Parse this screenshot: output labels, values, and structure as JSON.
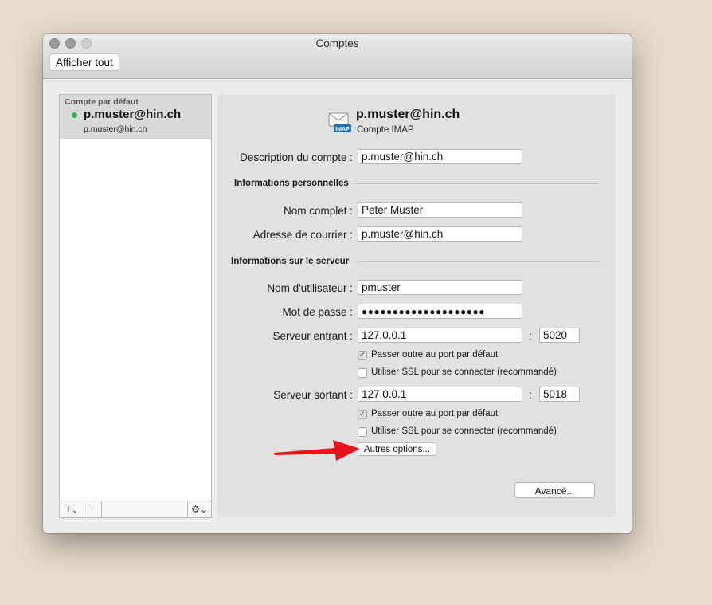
{
  "window": {
    "title": "Comptes",
    "show_all_label": "Afficher tout"
  },
  "sidebar": {
    "group_label": "Compte par défaut",
    "accounts": [
      {
        "name": "p.muster@hin.ch",
        "email": "p.muster@hin.ch",
        "status_color": "#2fb84a"
      }
    ],
    "add_label": "+",
    "add_chevron": "⌄",
    "remove_label": "−",
    "gear_label": "⚙⌄"
  },
  "account": {
    "header_email": "p.muster@hin.ch",
    "type": "Compte IMAP",
    "icon_badge": "IMAP",
    "icon": "mail-envelope-icon",
    "description_label": "Description du compte :",
    "description_value": "p.muster@hin.ch",
    "personal_section": "Informations personnelles",
    "full_name_label": "Nom complet :",
    "full_name_value": "Peter Muster",
    "email_label": "Adresse de courrier :",
    "email_value": "p.muster@hin.ch",
    "server_section": "Informations sur le serveur",
    "username_label": "Nom d'utilisateur :",
    "username_value": "pmuster",
    "password_label": "Mot de passe :",
    "password_value": "●●●●●●●●●●●●●●●●●●●●",
    "incoming_label": "Serveur entrant :",
    "incoming_host": "127.0.0.1",
    "incoming_port": "5020",
    "incoming_override_label": "Passer outre au port par défaut",
    "incoming_override_checked": true,
    "incoming_ssl_label": "Utiliser SSL pour se connecter (recommandé)",
    "incoming_ssl_checked": false,
    "outgoing_label": "Serveur sortant :",
    "outgoing_host": "127.0.0.1",
    "outgoing_port": "5018",
    "outgoing_override_label": "Passer outre au port par défaut",
    "outgoing_override_checked": true,
    "outgoing_ssl_label": "Utiliser SSL pour se connecter (recommandé)",
    "outgoing_ssl_checked": false,
    "colon": ":",
    "more_options_label": "Autres options...",
    "advanced_label": "Avancé...",
    "check_glyph": "✓"
  },
  "colors": {
    "annotation_arrow": "#e8141b",
    "status_online": "#2fb84a",
    "imap_badge": "#1f6fb3"
  }
}
